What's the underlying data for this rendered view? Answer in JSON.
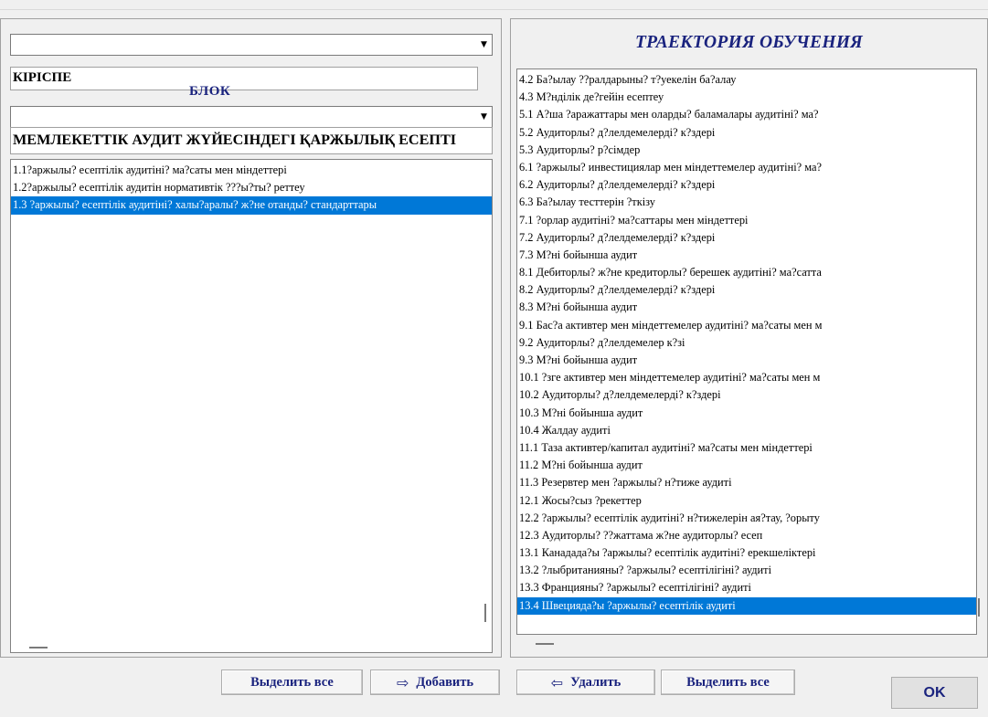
{
  "left": {
    "combo1": {
      "value": ""
    },
    "block_title": "КІРІСПЕ",
    "block_label": "БЛОК",
    "combo2": {
      "value": ""
    },
    "topic_title": "МЕМЛЕКЕТТІК АУДИТ ЖҮЙЕСІНДЕГІ ҚАРЖЫЛЫҚ ЕСЕПТІ",
    "items": [
      "1.1?аржылы? есептілік аудитіні? ма?саты мен міндеттері",
      "1.2?аржылы? есептілік аудитін нормативтік ???ы?ты? реттеу",
      "1.3 ?аржылы? есептілік аудитіні? халы?аралы? ж?не отанды? стандарттары"
    ],
    "selected_index": 2
  },
  "right": {
    "title": "ТРАЕКТОРИЯ ОБУЧЕНИЯ",
    "items": [
      "4.2 Ба?ылау ??ралдарыны? т?уекелін ба?алау",
      "4.3 М?нділік де?гейін есептеу",
      "5.1 А?ша ?аражаттары мен оларды? баламалары аудитіні? ма?",
      "5.2 Аудиторлы? д?лелдемелерді? к?здері",
      "5.3 Аудиторлы? р?сімдер",
      "6.1 ?аржылы? инвестициялар мен міндеттемелер аудитіні? ма?",
      "6.2 Аудиторлы? д?лелдемелерді? к?здері",
      "6.3 Ба?ылау тесттерін ?ткізу",
      "7.1 ?орлар аудитіні? ма?саттары мен міндеттері",
      "7.2 Аудиторлы? д?лелдемелерді? к?здері",
      "7.3 М?ні бойынша аудит",
      "8.1 Дебиторлы? ж?не кредиторлы? берешек аудитіні? ма?сатта",
      "8.2 Аудиторлы? д?лелдемелерді? к?здері",
      "8.3 М?ні бойынша аудит",
      "9.1 Бас?а активтер мен міндеттемелер аудитіні? ма?саты мен м",
      "9.2 Аудиторлы? д?лелдемелер к?зі",
      "9.3 М?ні бойынша аудит",
      "10.1 ?зге активтер мен міндеттемелер аудитіні? ма?саты мен м",
      "10.2 Аудиторлы? д?лелдемелерді? к?здері",
      "10.3 М?ні бойынша аудит",
      "10.4 Жалдау аудиті",
      "11.1 Таза активтер/капитал аудитіні? ма?саты мен міндеттері",
      "11.2 М?ні бойынша аудит",
      "11.3 Резервтер мен ?аржылы? н?тиже аудиті",
      "12.1 Жосы?сыз ?рекеттер",
      "12.2 ?аржылы? есептілік аудитіні? н?тижелерін ая?тау, ?орыту",
      "12.3 Аудиторлы? ??жаттама ж?не аудиторлы? есеп",
      "13.1 Канадада?ы ?аржылы? есептілік аудитіні? ерекшеліктері",
      "13.2 ?лыбританияны? ?аржылы? есептілігіні? аудиті",
      "13.3 Францияны? ?аржылы? есептілігіні? аудиті",
      "13.4 Швецияда?ы ?аржылы? есептілік аудиті"
    ],
    "selected_index": 30
  },
  "buttons": {
    "select_all_left": "Выделить все",
    "add": "Добавить",
    "remove": "Удалить",
    "select_all_right": "Выделить все",
    "ok": "OK"
  },
  "icons": {
    "add": "arrow-right-icon",
    "remove": "arrow-left-icon",
    "combo": "dropdown-arrow-icon"
  },
  "colors": {
    "selection": "#0078d7",
    "title_text": "#1a237e"
  }
}
